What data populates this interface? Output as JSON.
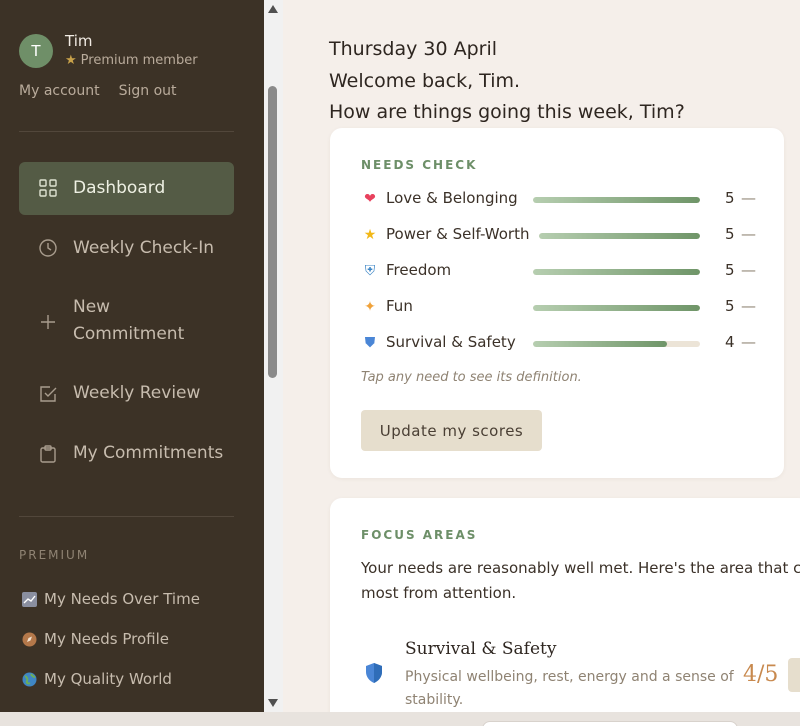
{
  "user": {
    "initial": "T",
    "name": "Tim",
    "tier": "Premium member",
    "links": {
      "account": "My account",
      "signout": "Sign out"
    }
  },
  "nav": [
    {
      "label": "Dashboard",
      "icon": "grid-icon",
      "active": true
    },
    {
      "label": "Weekly Check-In",
      "icon": "clock-icon"
    },
    {
      "label": "New Commitment",
      "icon": "plus-icon"
    },
    {
      "label": "Weekly Review",
      "icon": "checkbox-icon"
    },
    {
      "label": "My Commitments",
      "icon": "clipboard-icon"
    }
  ],
  "premium": {
    "heading": "PREMIUM",
    "items": [
      {
        "label": "My Needs Over Time",
        "icon": "chart-icon"
      },
      {
        "label": "My Needs Profile",
        "icon": "compass-icon"
      },
      {
        "label": "My Quality World",
        "icon": "globe-icon"
      }
    ]
  },
  "header": {
    "date": "Thursday 30 April",
    "welcome": "Welcome back, Tim.",
    "prompt": "How are things going this week, Tim?"
  },
  "needs": {
    "title": "NEEDS CHECK",
    "max": 5,
    "items": [
      {
        "emoji": "❤",
        "emoji_color": "#e8415d",
        "label": "Love & Belonging",
        "score": 5
      },
      {
        "emoji": "★",
        "emoji_color": "#f2b818",
        "label": "Power & Self-Worth",
        "score": 5
      },
      {
        "emoji": "⛨",
        "emoji_color": "#3d86c6",
        "label": "Freedom",
        "score": 5
      },
      {
        "emoji": "✦",
        "emoji_color": "#f0a23a",
        "label": "Fun",
        "score": 5
      },
      {
        "emoji": "⛊",
        "emoji_color": "#4a86d6",
        "label": "Survival & Safety",
        "score": 4
      }
    ],
    "dash": "—",
    "hint": "Tap any need to see its definition.",
    "update_label": "Update my scores"
  },
  "focus": {
    "title": "FOCUS AREAS",
    "intro_line1": "Your needs are reasonably well met. Here's the area that coul",
    "intro_line2": "most from attention.",
    "area_name": "Survival & Safety",
    "area_desc": "Physical wellbeing, rest, energy and a sense of stability.",
    "area_score": "4/5"
  },
  "colors": {
    "sidebar_bg": "#3c3226",
    "active_bg": "#545b45",
    "accent_green": "#6d8f68",
    "accent_orange": "#c8894e"
  }
}
